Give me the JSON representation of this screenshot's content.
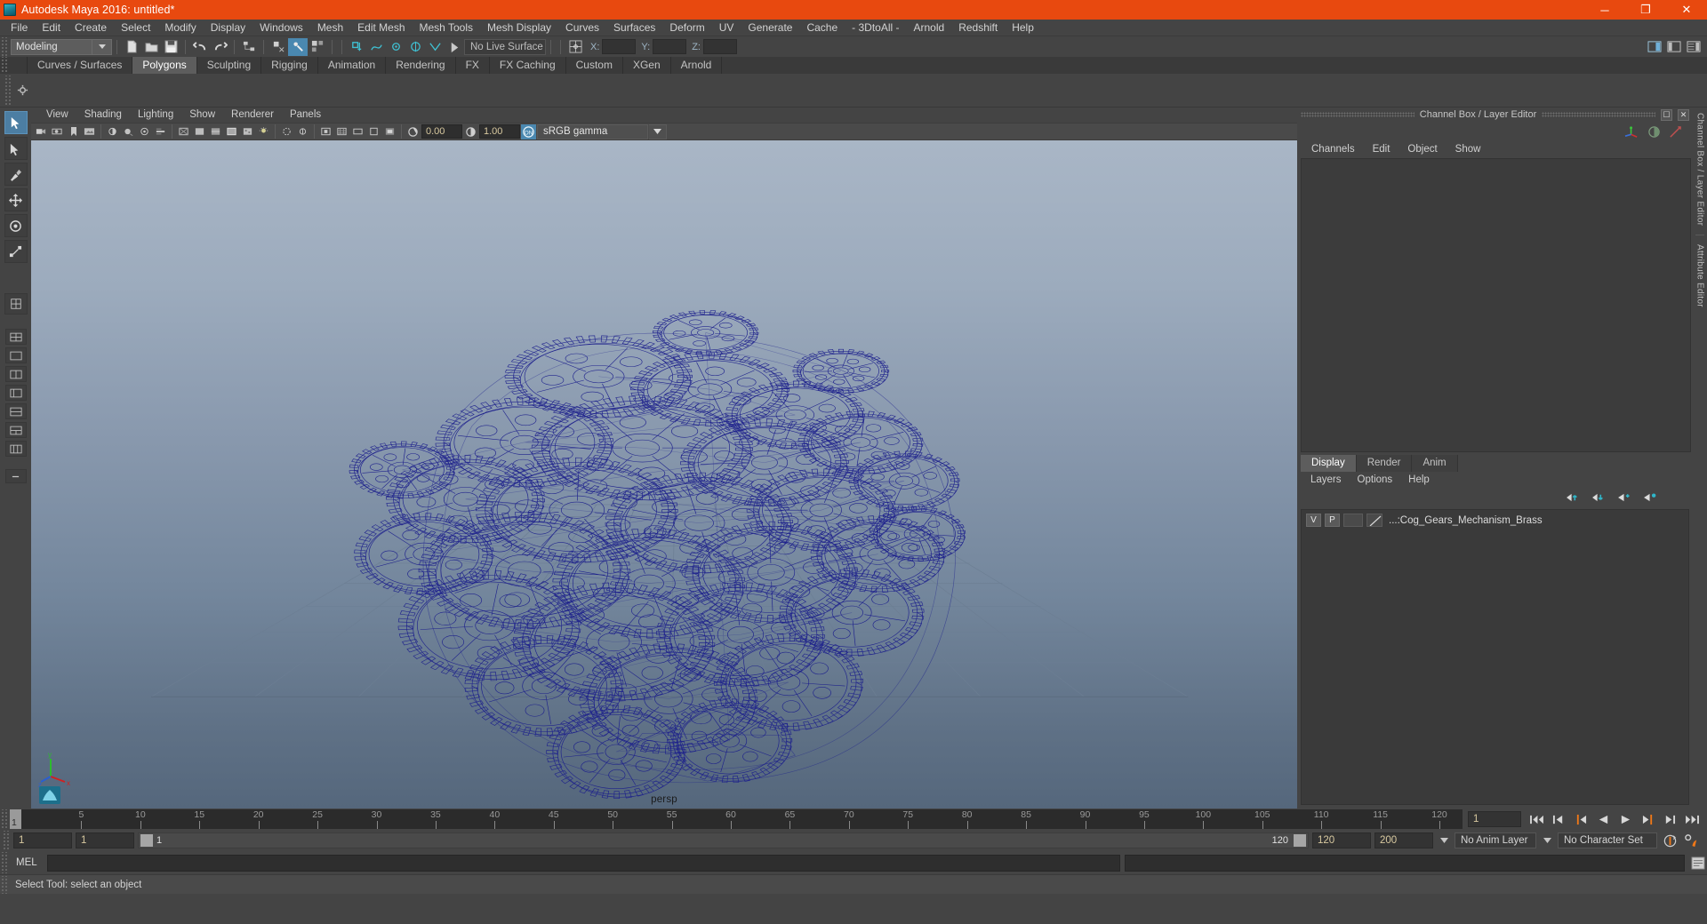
{
  "window": {
    "title": "Autodesk Maya 2016: untitled*",
    "minimize": "─",
    "maximize": "❐",
    "close": "✕",
    "accent": "#e8490f"
  },
  "menubar": {
    "items": [
      "File",
      "Edit",
      "Create",
      "Select",
      "Modify",
      "Display",
      "Windows",
      "Mesh",
      "Edit Mesh",
      "Mesh Tools",
      "Mesh Display",
      "Curves",
      "Surfaces",
      "Deform",
      "UV",
      "Generate",
      "Cache",
      "- 3DtoAll -",
      "Arnold",
      "Redshift",
      "Help"
    ]
  },
  "statusline": {
    "selection_mode": "Modeling",
    "live_surface": "No Live Surface",
    "x_label": "X:",
    "y_label": "Y:",
    "z_label": "Z:",
    "x_value": "",
    "y_value": "",
    "z_value": ""
  },
  "shelf": {
    "tabs": [
      "Curves / Surfaces",
      "Polygons",
      "Sculpting",
      "Rigging",
      "Animation",
      "Rendering",
      "FX",
      "FX Caching",
      "Custom",
      "XGen",
      "Arnold"
    ],
    "active_tab": "Polygons"
  },
  "viewport": {
    "panel_menus": [
      "View",
      "Shading",
      "Lighting",
      "Show",
      "Renderer",
      "Panels"
    ],
    "exposure_value": "0.00",
    "gamma_value": "1.00",
    "color_space": "sRGB gamma",
    "camera_label": "persp",
    "axis_x": "x",
    "axis_y": "y",
    "axis_z": "z",
    "wireframe_color": "#1c1f8c",
    "bg_top": "#a9b6c6",
    "bg_bottom": "#55677c"
  },
  "channelbox": {
    "dock_title": "Channel Box / Layer Editor",
    "menus": [
      "Channels",
      "Edit",
      "Object",
      "Show"
    ]
  },
  "layereditor": {
    "tabs": [
      "Display",
      "Render",
      "Anim"
    ],
    "active_tab": "Display",
    "menus": [
      "Layers",
      "Options",
      "Help"
    ],
    "layers": [
      {
        "visible": "V",
        "playback": "P",
        "name": "...:Cog_Gears_Mechanism_Brass"
      }
    ]
  },
  "rightstrip": {
    "labels": [
      "Channel Box / Layer Editor",
      "Attribute Editor"
    ]
  },
  "timeslider": {
    "current_frame": "1",
    "start_visible": "1",
    "end_visible": "120",
    "ticks": [
      5,
      10,
      15,
      20,
      25,
      30,
      35,
      40,
      45,
      50,
      55,
      60,
      65,
      70,
      75,
      80,
      85,
      90,
      95,
      100,
      105,
      110,
      115,
      120
    ],
    "playback_field": "1"
  },
  "rangeslider": {
    "anim_start": "1",
    "range_start": "1",
    "bar_start_label": "1",
    "bar_end_label": "120",
    "range_end": "120",
    "anim_end": "200",
    "anim_layer": "No Anim Layer",
    "character_set": "No Character Set"
  },
  "commandline": {
    "label": "MEL",
    "value": "",
    "placeholder": ""
  },
  "helpline": {
    "text": "Select Tool: select an object"
  }
}
